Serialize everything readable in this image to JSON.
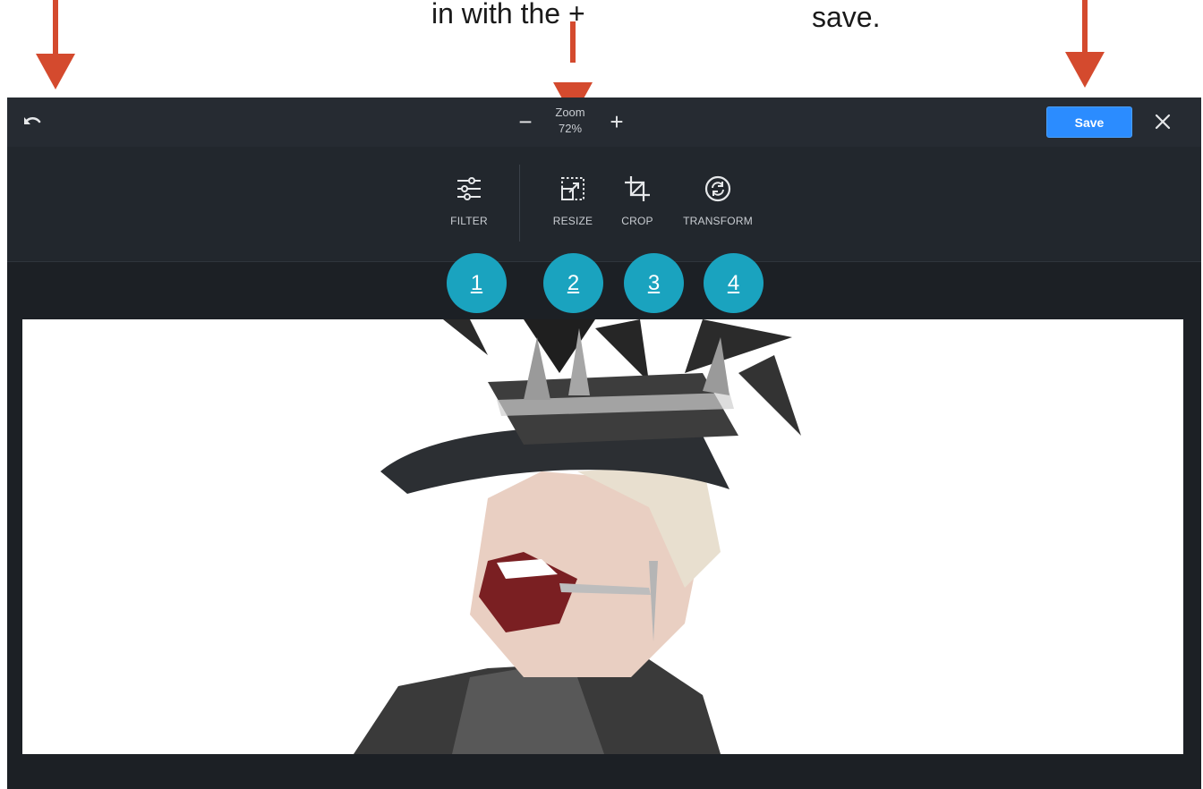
{
  "callouts": {
    "zoom_text": "in with the +",
    "save_text": "save."
  },
  "topbar": {
    "undo_icon": "undo-icon",
    "zoom_minus": "−",
    "zoom_plus": "+",
    "zoom_label": "Zoom",
    "zoom_value": "72%",
    "save_label": "Save",
    "close_icon": "close-icon"
  },
  "toolbar": {
    "tools": [
      {
        "label": "FILTER",
        "icon": "sliders-icon"
      },
      {
        "label": "RESIZE",
        "icon": "resize-icon"
      },
      {
        "label": "CROP",
        "icon": "crop-icon"
      },
      {
        "label": "TRANSFORM",
        "icon": "rotate-icon"
      }
    ]
  },
  "badges": [
    "1",
    "2",
    "3",
    "4"
  ],
  "colors": {
    "editor_bg": "#1c2025",
    "topbar_bg": "#262b32",
    "toolbar_bg": "#22272d",
    "accent_save": "#2b8cff",
    "badge": "#1aa3bf",
    "arrow": "#d44a2e"
  }
}
